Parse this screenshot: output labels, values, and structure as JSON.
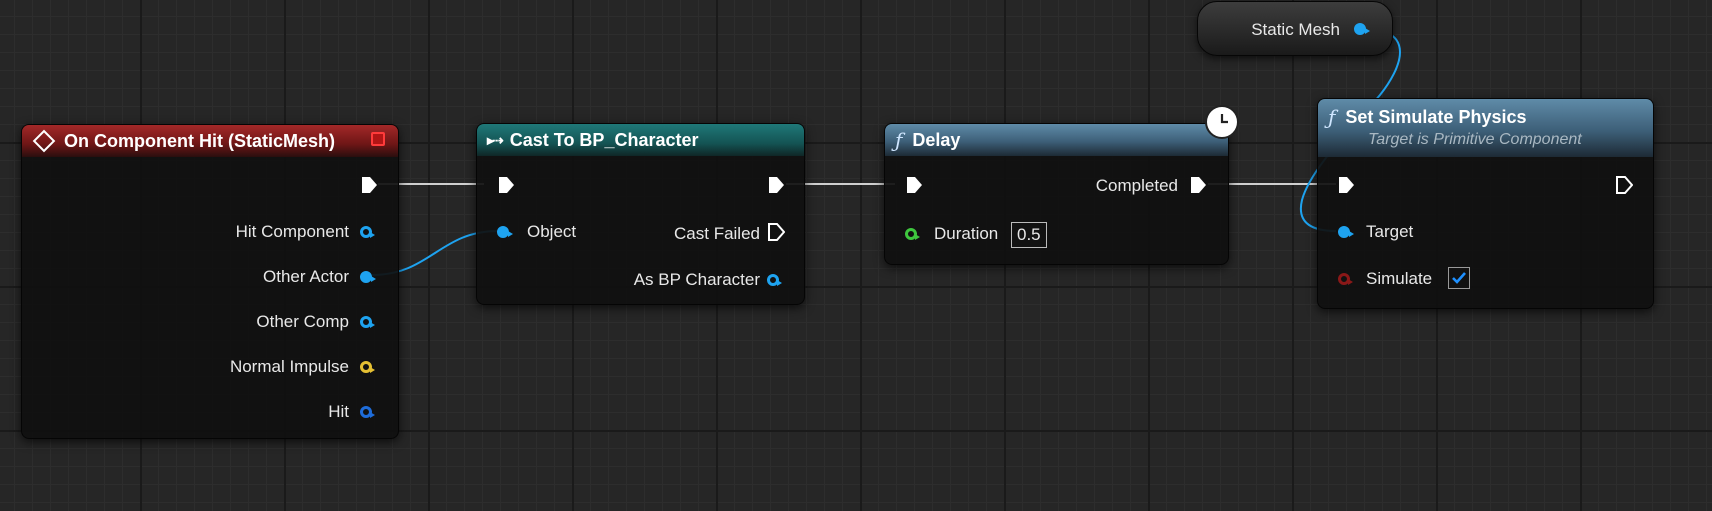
{
  "colors": {
    "exec_wire": "#cfcfcf",
    "object_wire": "#1ea3f0",
    "event_header": "#a32828",
    "cast_header": "#1f7878",
    "function_header": "#4a7494"
  },
  "nodes": {
    "event": {
      "title": "On Component Hit (StaticMesh)",
      "icon": "event-diamond-icon",
      "pins": {
        "hit_component": "Hit Component",
        "other_actor": "Other Actor",
        "other_comp": "Other Comp",
        "normal_impulse": "Normal Impulse",
        "hit": "Hit"
      }
    },
    "cast": {
      "title": "Cast To BP_Character",
      "icon": "cast-arrow-icon",
      "pins": {
        "object": "Object",
        "cast_failed": "Cast Failed",
        "as_bp_character": "As BP Character"
      }
    },
    "delay": {
      "title": "Delay",
      "icon": "function-icon",
      "pins": {
        "completed": "Completed",
        "duration": "Duration"
      },
      "duration_value": "0.5"
    },
    "static_mesh": {
      "label": "Static Mesh"
    },
    "set_simulate": {
      "title": "Set Simulate Physics",
      "subtitle": "Target is Primitive Component",
      "icon": "function-icon",
      "pins": {
        "target": "Target",
        "simulate": "Simulate"
      },
      "simulate_checked": true
    }
  }
}
